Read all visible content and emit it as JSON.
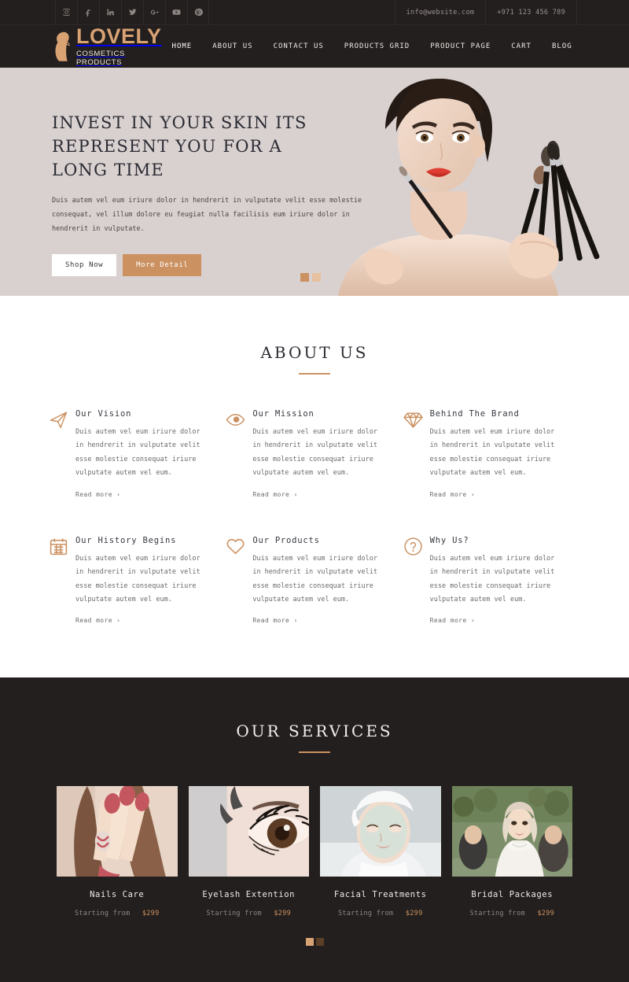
{
  "topbar": {
    "social": [
      {
        "name": "instagram-icon",
        "label": "Instagram"
      },
      {
        "name": "facebook-icon",
        "label": "Facebook"
      },
      {
        "name": "linkedin-icon",
        "label": "LinkedIn"
      },
      {
        "name": "twitter-icon",
        "label": "Twitter"
      },
      {
        "name": "google-plus-icon",
        "label": "Google Plus"
      },
      {
        "name": "youtube-icon",
        "label": "YouTube"
      },
      {
        "name": "pinterest-icon",
        "label": "Pinterest"
      }
    ],
    "email": "info@website.com",
    "phone": "+971 123 456 789"
  },
  "header": {
    "brand_name": "LOVELY",
    "brand_tagline": "COSMETICS PRODUCTS",
    "nav": [
      {
        "label": "HOME",
        "active": true
      },
      {
        "label": "ABOUT US",
        "active": false
      },
      {
        "label": "CONTACT US",
        "active": false
      },
      {
        "label": "PRODUCTS GRID",
        "active": false
      },
      {
        "label": "PRODUCT PAGE",
        "active": false
      },
      {
        "label": "CART",
        "active": false
      },
      {
        "label": "BLOG",
        "active": false
      }
    ]
  },
  "hero": {
    "title": "INVEST IN YOUR SKIN ITS REPRESENT YOU FOR A LONG TIME",
    "description": "Duis autem vel eum iriure dolor in hendrerit in vulputate velit esse molestie consequat, vel illum dolore eu feugiat nulla facilisis eum iriure dolor in hendrerit in vulputate.",
    "primary_button": "Shop Now",
    "secondary_button": "More Detail",
    "slides": 2,
    "active_slide": 1,
    "background_color": "#d9d1d0"
  },
  "about": {
    "title": "ABOUT US",
    "read_more": "Read more  ›",
    "body": "Duis autem vel eum iriure dolor in hendrerit in vulputate velit esse molestie consequat iriure vulputate autem vel eum.",
    "items": [
      {
        "icon": "paper-plane-icon",
        "title": "Our Vision"
      },
      {
        "icon": "eye-icon",
        "title": "Our Mission"
      },
      {
        "icon": "diamond-icon",
        "title": "Behind The Brand"
      },
      {
        "icon": "calendar-icon",
        "title": "Our History Begins"
      },
      {
        "icon": "heart-icon",
        "title": "Our Products"
      },
      {
        "icon": "question-circle-icon",
        "title": "Why Us?"
      }
    ]
  },
  "services": {
    "title": "OUR SERVICES",
    "price_label": "Starting from",
    "items": [
      {
        "name": "Nails Care",
        "price": "$299",
        "image": "nails-care-photo"
      },
      {
        "name": "Eyelash Extention",
        "price": "$299",
        "image": "eyelash-extention-photo"
      },
      {
        "name": "Facial Treatments",
        "price": "$299",
        "image": "facial-treatments-photo"
      },
      {
        "name": "Bridal Packages",
        "price": "$299",
        "image": "bridal-packages-photo"
      }
    ],
    "slides": 2,
    "active_slide": 1
  },
  "colors": {
    "accent": "#cb9161",
    "dark": "#231f1e",
    "logo_gold": "#d9a273"
  }
}
